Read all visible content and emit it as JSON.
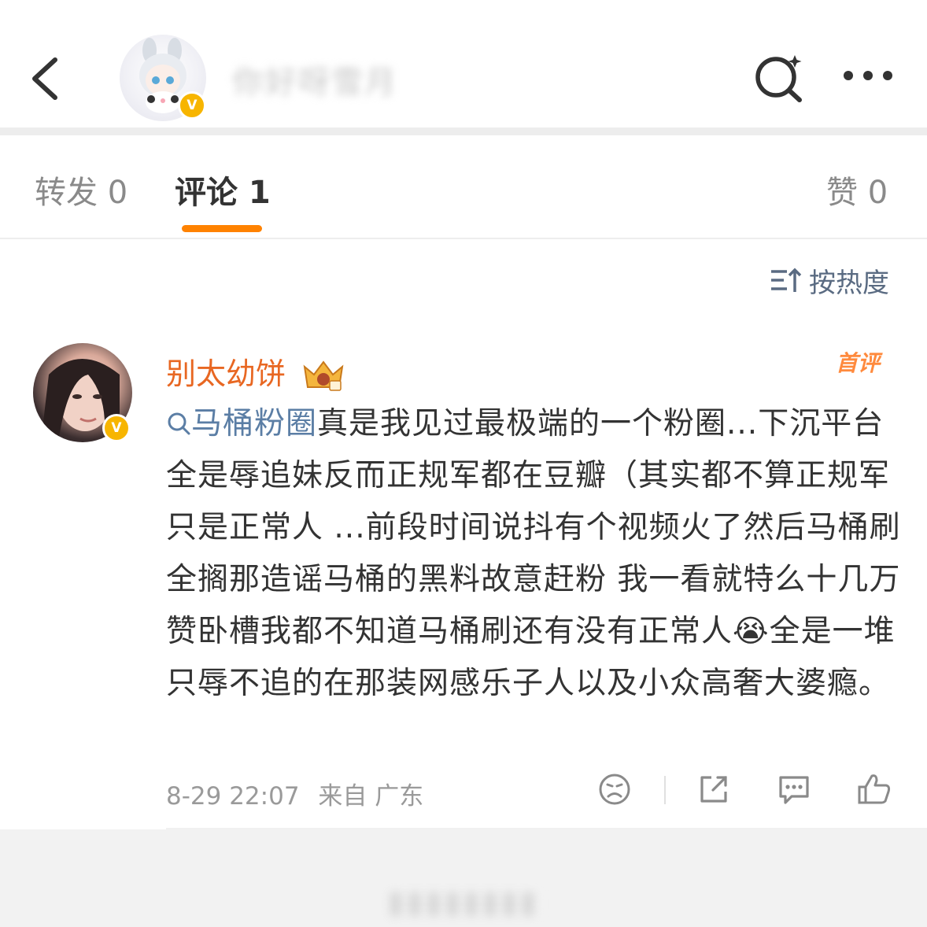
{
  "header": {
    "title": "",
    "author_name_blurred": "你好呀雪月"
  },
  "tabs": [
    {
      "label": "转发 0"
    },
    {
      "label": "评论 1"
    },
    {
      "label": "赞 0"
    }
  ],
  "sort": {
    "label": "按热度"
  },
  "comment": {
    "author": "别太幼饼",
    "badge": "首评",
    "topic": "马桶粉圈",
    "text_1": "真是我见过最极端的一个粉圈...下沉平台全是辱追妹反而正规军都在豆瓣（其实都不算正规军只是正常人 ...前段时间说抖有个视频火了然后马桶刷全搁那造谣马桶的黑料故意赶粉 我一看就特么十几万赞卧槽我都不知道马桶刷还有没有正常人",
    "emoji": "😭",
    "text_2": "全是一堆只辱不追的在那装网感乐子人以及小众高奢大婆瘾。",
    "time": "8-29 22:07",
    "location": "来自 广东"
  },
  "colors": {
    "accent": "#ff8200",
    "name": "#e86722",
    "topic": "#5b7ea5",
    "verified": "#f7b500"
  }
}
